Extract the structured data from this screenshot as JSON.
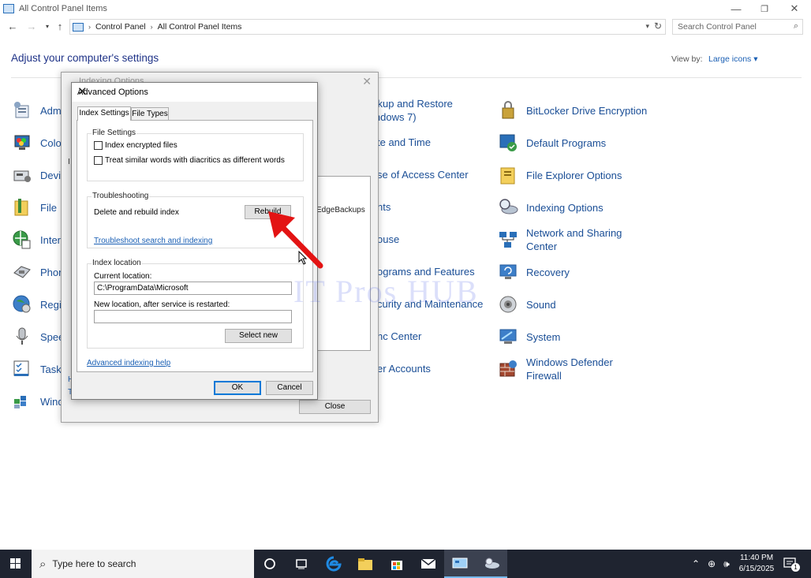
{
  "window": {
    "title": "All Control Panel Items",
    "minimize": "—",
    "restore": "❐",
    "close": "✕"
  },
  "address_bar": {
    "crumbs": [
      "Control Panel",
      "All Control Panel Items"
    ],
    "search_placeholder": "Search Control Panel"
  },
  "header": {
    "title": "Adjust your computer's settings",
    "view_by_label": "View by:",
    "view_by_value": "Large icons ▾"
  },
  "items_left": [
    {
      "label": "Adm",
      "icon": "admin-tools-icon"
    },
    {
      "label": "Colo",
      "icon": "color-management-icon"
    },
    {
      "label": "Devi",
      "icon": "device-manager-icon"
    },
    {
      "label": "File",
      "icon": "file-history-icon"
    },
    {
      "label": "Inter",
      "icon": "internet-options-icon"
    },
    {
      "label": "Phon",
      "icon": "phone-modem-icon"
    },
    {
      "label": "Regi",
      "icon": "region-icon"
    },
    {
      "label": "Spee",
      "icon": "speech-icon"
    },
    {
      "label": "Task",
      "icon": "taskbar-icon"
    },
    {
      "label": "Wind",
      "icon": "windows-mobility-icon"
    }
  ],
  "items_mid": [
    {
      "label": "ckup and Restore\nindows 7)"
    },
    {
      "label": "te and Time"
    },
    {
      "label": "se of Access Center"
    },
    {
      "label": "nts"
    },
    {
      "label": "ouse"
    },
    {
      "label": "ograms and Features"
    },
    {
      "label": "curity and Maintenance"
    },
    {
      "label": "nc Center"
    },
    {
      "label": "er Accounts"
    }
  ],
  "items_right": [
    {
      "label": "BitLocker Drive Encryption",
      "icon": "bitlocker-icon"
    },
    {
      "label": "Default Programs",
      "icon": "default-programs-icon"
    },
    {
      "label": "File Explorer Options",
      "icon": "file-explorer-options-icon"
    },
    {
      "label": "Indexing Options",
      "icon": "indexing-options-icon"
    },
    {
      "label": "Network and Sharing\nCenter",
      "icon": "network-sharing-icon"
    },
    {
      "label": "Recovery",
      "icon": "recovery-icon"
    },
    {
      "label": "Sound",
      "icon": "sound-icon"
    },
    {
      "label": "System",
      "icon": "system-icon"
    },
    {
      "label": "Windows Defender\nFirewall",
      "icon": "firewall-icon"
    }
  ],
  "indexing_dialog": {
    "title": "Indexing Options",
    "list_item": "EdgeBackups",
    "close_button": "Close",
    "frag_i": "I",
    "frag_h": "H",
    "frag_t": "T"
  },
  "advanced_dialog": {
    "title": "Advanced Options",
    "tabs": [
      "Index Settings",
      "File Types"
    ],
    "file_settings": {
      "label": "File Settings",
      "encrypt": "Index encrypted files",
      "diacritics": "Treat similar words with diacritics as different words"
    },
    "troubleshooting": {
      "label": "Troubleshooting",
      "rebuild_text": "Delete and rebuild index",
      "rebuild_button": "Rebuild",
      "link": "Troubleshoot search and indexing"
    },
    "index_location": {
      "label": "Index location",
      "current_label": "Current location:",
      "current_value": "C:\\ProgramData\\Microsoft",
      "new_label": "New location, after service is restarted:",
      "new_value": "",
      "select_new": "Select new"
    },
    "help_link": "Advanced indexing help",
    "ok": "OK",
    "cancel": "Cancel"
  },
  "watermark": "IT Pros HUB",
  "taskbar": {
    "search_placeholder": "Type here to search",
    "time": "11:40 PM",
    "date": "6/15/2025",
    "notification_count": "1"
  }
}
